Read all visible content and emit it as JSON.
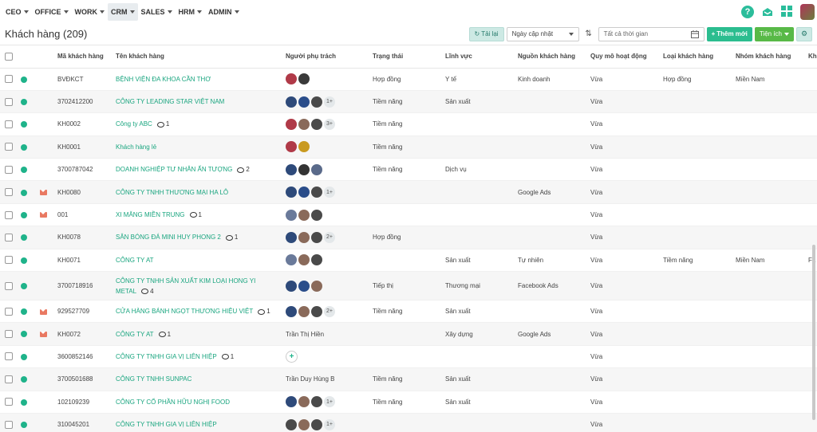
{
  "nav": {
    "items": [
      {
        "label": "CEO"
      },
      {
        "label": "OFFICE"
      },
      {
        "label": "WORK"
      },
      {
        "label": "CRM"
      },
      {
        "label": "SALES"
      },
      {
        "label": "HRM"
      },
      {
        "label": "ADMIN"
      }
    ],
    "active": "CRM"
  },
  "header": {
    "title": "Khách hàng (209)",
    "reload_label": "Tải lại",
    "sort_value": "Ngày cập nhật",
    "date_placeholder": "Tất cả thời gian",
    "add_label": "Thêm mới",
    "utilities_label": "Tiện ích"
  },
  "table": {
    "columns": [
      "Mã khách hàng",
      "Tên khách hàng",
      "Người phụ trách",
      "Trạng thái",
      "Lĩnh vực",
      "Nguồn khách hàng",
      "Quy mô hoạt động",
      "Loại khách hàng",
      "Nhóm khách hàng",
      "Kh"
    ],
    "rows": [
      {
        "code": "BVĐKCT",
        "name": "BỆNH VIỆN ĐA KHOA CẦN THƠ",
        "comments": "",
        "mail": false,
        "owners_text": "",
        "more": "",
        "status": "Hợp đồng",
        "field": "Y tế",
        "source": "Kinh doanh",
        "scale": "Vừa",
        "type": "Hợp đồng",
        "group": "Miền Nam",
        "extra": ""
      },
      {
        "code": "3702412200",
        "name": "CÔNG TY LEADING STAR VIỆT NAM",
        "comments": "",
        "mail": false,
        "owners_text": "",
        "more": "1+",
        "status": "Tiềm năng",
        "field": "Sản xuất",
        "source": "",
        "scale": "Vừa",
        "type": "",
        "group": "",
        "extra": ""
      },
      {
        "code": "KH0002",
        "name": "Công ty ABC",
        "comments": "1",
        "mail": false,
        "owners_text": "",
        "more": "3+",
        "status": "Tiềm năng",
        "field": "",
        "source": "",
        "scale": "Vừa",
        "type": "",
        "group": "",
        "extra": ""
      },
      {
        "code": "KH0001",
        "name": "Khách hàng lẻ",
        "comments": "",
        "mail": false,
        "owners_text": "",
        "more": "",
        "status": "Tiềm năng",
        "field": "",
        "source": "",
        "scale": "Vừa",
        "type": "",
        "group": "",
        "extra": ""
      },
      {
        "code": "3700787042",
        "name": "DOANH NGHIỆP TƯ NHÂN ẤN TƯỢNG",
        "comments": "2",
        "mail": false,
        "owners_text": "",
        "more": "",
        "status": "Tiềm năng",
        "field": "Dịch vụ",
        "source": "",
        "scale": "Vừa",
        "type": "",
        "group": "",
        "extra": ""
      },
      {
        "code": "KH0080",
        "name": "CÔNG TY TNHH THƯƠNG MẠI HA LÔ",
        "comments": "",
        "mail": true,
        "owners_text": "",
        "more": "1+",
        "status": "",
        "field": "",
        "source": "Google Ads",
        "scale": "Vừa",
        "type": "",
        "group": "",
        "extra": ""
      },
      {
        "code": "001",
        "name": "XI MĂNG MIỀN TRUNG",
        "comments": "1",
        "mail": true,
        "owners_text": "",
        "more": "",
        "status": "",
        "field": "",
        "source": "",
        "scale": "Vừa",
        "type": "",
        "group": "",
        "extra": ""
      },
      {
        "code": "KH0078",
        "name": "SÂN BÓNG ĐÁ MINI HUY PHONG 2",
        "comments": "1",
        "mail": false,
        "owners_text": "",
        "more": "2+",
        "status": "Hợp đồng",
        "field": "",
        "source": "",
        "scale": "Vừa",
        "type": "",
        "group": "",
        "extra": ""
      },
      {
        "code": "KH0071",
        "name": "CÔNG TY AT",
        "comments": "",
        "mail": false,
        "owners_text": "",
        "more": "",
        "status": "",
        "field": "Sản xuất",
        "source": "Tự nhiên",
        "scale": "Vừa",
        "type": "Tiềm năng",
        "group": "Miền Nam",
        "extra": "Fa"
      },
      {
        "code": "3700718916",
        "name": "CÔNG TY TNHH SẢN XUẤT KIM LOẠI HONG YI",
        "name2": "METAL",
        "comments": "4",
        "mail": false,
        "owners_text": "",
        "more": "",
        "status": "Tiếp thị",
        "field": "Thương mại",
        "source": "Facebook Ads",
        "scale": "Vừa",
        "type": "",
        "group": "",
        "extra": ""
      },
      {
        "code": "929527709",
        "name": "CỬA HÀNG BÁNH NGỌT THƯƠNG HIỆU VIỆT",
        "comments": "1",
        "mail": true,
        "owners_text": "",
        "more": "2+",
        "status": "Tiềm năng",
        "field": "Sản xuất",
        "source": "",
        "scale": "Vừa",
        "type": "",
        "group": "",
        "extra": ""
      },
      {
        "code": "KH0072",
        "name": "CÔNG TY AT",
        "comments": "1",
        "mail": true,
        "owners_text": "Trần Thị Hiền",
        "more": "",
        "status": "",
        "field": "Xây dựng",
        "source": "Google Ads",
        "scale": "Vừa",
        "type": "",
        "group": "",
        "extra": ""
      },
      {
        "code": "3600852146",
        "name": "CÔNG TY TNHH GIA VỊ LIÊN HIỆP",
        "comments": "1",
        "mail": false,
        "owners_text": "",
        "more": "",
        "status": "",
        "field": "",
        "source": "",
        "scale": "Vừa",
        "type": "",
        "group": "",
        "extra": ""
      },
      {
        "code": "3700501688",
        "name": "CÔNG TY TNHH SUNPAC",
        "comments": "",
        "mail": false,
        "owners_text": "Trần Duy Hùng B",
        "more": "",
        "status": "Tiềm năng",
        "field": "Sản xuất",
        "source": "",
        "scale": "Vừa",
        "type": "",
        "group": "",
        "extra": ""
      },
      {
        "code": "102109239",
        "name": "CÔNG TY CỔ PHẦN HỮU NGHỊ FOOD",
        "comments": "",
        "mail": false,
        "owners_text": "",
        "more": "1+",
        "status": "Tiềm năng",
        "field": "Sản xuất",
        "source": "",
        "scale": "Vừa",
        "type": "",
        "group": "",
        "extra": ""
      },
      {
        "code": "310045201",
        "name": "CÔNG TY TNHH GIA VỊ LIÊN HIỆP",
        "comments": "",
        "mail": false,
        "owners_text": "",
        "more": "1+",
        "status": "",
        "field": "",
        "source": "",
        "scale": "Vừa",
        "type": "",
        "group": "",
        "extra": ""
      }
    ]
  },
  "colors": {
    "accent": "#1fb38a",
    "mail": "#e97962",
    "add_button": "#2bbd8f",
    "utilities_button": "#58b947"
  }
}
